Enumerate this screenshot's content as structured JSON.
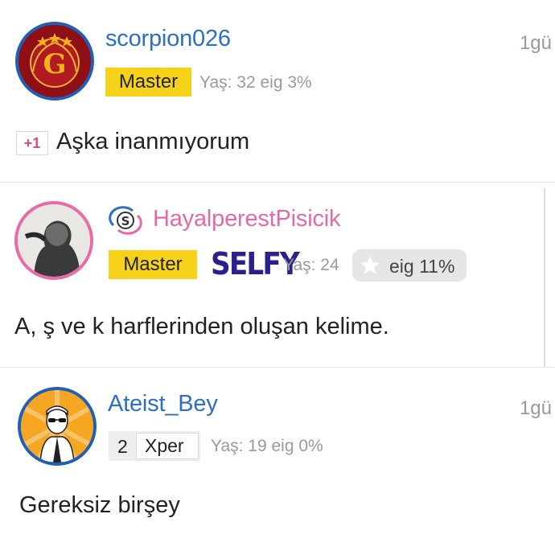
{
  "comments": [
    {
      "username": "scorpion026",
      "time": "1gü",
      "badge": "Master",
      "meta": "Yaş: 32 eig 3%",
      "vote": "+1",
      "text": "Aşka inanmıyorum",
      "avatar_icon": "galatasaray-logo-icon"
    },
    {
      "username": "HayalperestPisicik",
      "badge": "Master",
      "brand": "SELFY",
      "meta": "Yaş: 24",
      "eig": "eig 11%",
      "text": "A, ş ve k harflerinden oluşan kelime.",
      "avatar_icon": "profile-photo-icon"
    },
    {
      "username": "Ateist_Bey",
      "time": "1gü",
      "level": "2",
      "xp_badge": "Xper",
      "meta": "Yaş: 19 eig 0%",
      "text": "Gereksiz birşey",
      "avatar_icon": "man-with-sunglasses-icon"
    }
  ],
  "colors": {
    "link_blue": "#2b6fc6",
    "pink": "#e36aa8",
    "master_yellow": "#f6d21a",
    "meta_gray": "#9a9a9a"
  }
}
